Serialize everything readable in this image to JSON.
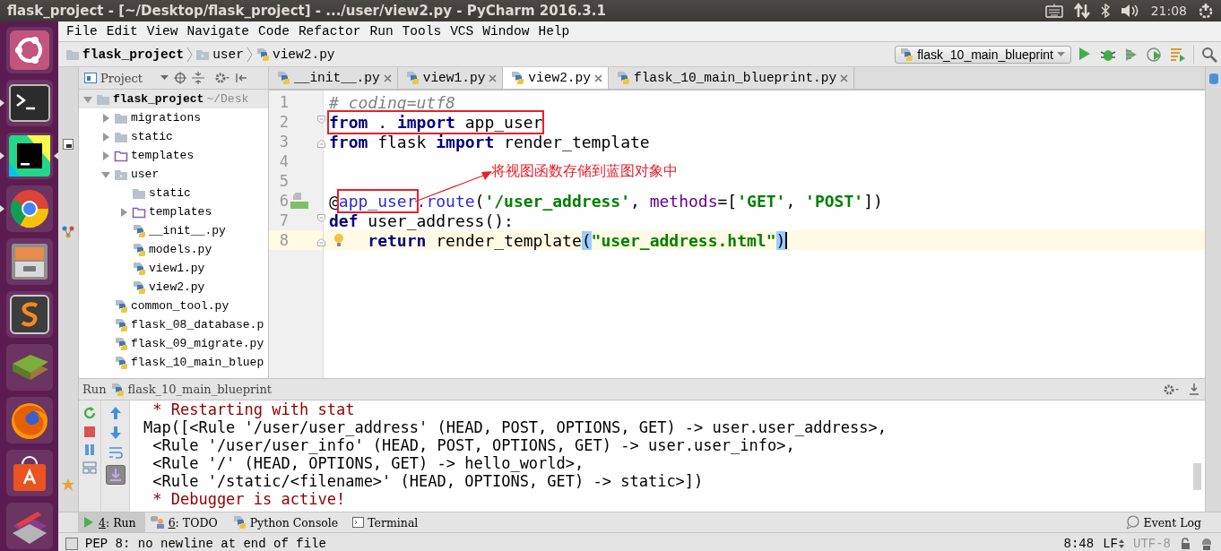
{
  "top_bar": {
    "title": "flask_project - [~/Desktop/flask_project] - .../user/view2.py - PyCharm 2016.3.1",
    "clock": "21:08"
  },
  "launcher": [
    {
      "kind": "ubuntu",
      "running": false,
      "focused": false
    },
    {
      "kind": "terminal",
      "running": true,
      "focused": false
    },
    {
      "kind": "ide",
      "running": true,
      "focused": true
    },
    {
      "kind": "browser",
      "running": true,
      "focused": false
    },
    {
      "kind": "files",
      "running": false,
      "focused": false
    },
    {
      "kind": "text-editor",
      "running": false,
      "focused": false
    },
    {
      "kind": "books",
      "running": false,
      "focused": false
    },
    {
      "kind": "firefox",
      "running": false,
      "focused": false
    },
    {
      "kind": "store",
      "running": false,
      "focused": false
    },
    {
      "kind": "settings",
      "running": false,
      "focused": false
    }
  ],
  "menu": [
    "File",
    "Edit",
    "View",
    "Navigate",
    "Code",
    "Refactor",
    "Run",
    "Tools",
    "VCS",
    "Window",
    "Help"
  ],
  "breadcrumb": [
    {
      "label": "flask_project",
      "kind": "project"
    },
    {
      "label": "user",
      "kind": "package"
    },
    {
      "label": "view2.py",
      "kind": "python-file"
    }
  ],
  "run_config": {
    "label": "flask_10_main_blueprint"
  },
  "project_panel": {
    "title": "Project",
    "tree": [
      {
        "label": "flask_project",
        "hint": "~/Desk",
        "kind": "project",
        "expanded": true,
        "children": [
          {
            "label": "migrations",
            "kind": "folder",
            "expanded": false
          },
          {
            "label": "static",
            "kind": "folder",
            "expanded": false
          },
          {
            "label": "templates",
            "kind": "template-folder",
            "expanded": false
          },
          {
            "label": "user",
            "kind": "package",
            "expanded": true,
            "children": [
              {
                "label": "static",
                "kind": "folder"
              },
              {
                "label": "templates",
                "kind": "template-folder",
                "expanded": false
              },
              {
                "label": "__init__.py",
                "kind": "python-file"
              },
              {
                "label": "models.py",
                "kind": "python-file"
              },
              {
                "label": "view1.py",
                "kind": "python-file"
              },
              {
                "label": "view2.py",
                "kind": "python-file"
              }
            ]
          },
          {
            "label": "common_tool.py",
            "kind": "python-file"
          },
          {
            "label": "flask_08_database.p",
            "kind": "python-file"
          },
          {
            "label": "flask_09_migrate.py",
            "kind": "python-file"
          },
          {
            "label": "flask_10_main_bluep",
            "kind": "python-file"
          }
        ]
      }
    ]
  },
  "editor": {
    "tabs": [
      {
        "label": "__init__.py",
        "selected": false
      },
      {
        "label": "view1.py",
        "selected": false
      },
      {
        "label": "view2.py",
        "selected": true
      },
      {
        "label": "flask_10_main_blueprint.py",
        "selected": false
      }
    ],
    "lines": [
      {
        "number": "1",
        "current": false,
        "fold_start": false,
        "fold_end": false,
        "bookmark": false,
        "bulb": false,
        "tokens": [
          {
            "text": "# coding=utf8",
            "kind": "comment"
          }
        ]
      },
      {
        "number": "2",
        "current": false,
        "fold_start": true,
        "fold_end": false,
        "bookmark": false,
        "bulb": false,
        "tokens": [
          {
            "text": "from",
            "kind": "keyword",
            "boxed": true
          },
          {
            "text": " . ",
            "kind": "plain",
            "boxed": true
          },
          {
            "text": "import",
            "kind": "keyword",
            "boxed": true
          },
          {
            "text": " app_user",
            "kind": "plain",
            "boxed": true
          }
        ]
      },
      {
        "number": "3",
        "current": false,
        "fold_start": false,
        "fold_end": true,
        "bookmark": false,
        "bulb": false,
        "tokens": [
          {
            "text": "from",
            "kind": "keyword"
          },
          {
            "text": " flask ",
            "kind": "plain"
          },
          {
            "text": "import",
            "kind": "keyword"
          },
          {
            "text": " render_template",
            "kind": "plain"
          }
        ]
      },
      {
        "number": "4",
        "current": false,
        "fold_start": false,
        "fold_end": false,
        "bookmark": false,
        "bulb": false
      },
      {
        "number": "5",
        "current": false,
        "fold_start": false,
        "fold_end": false,
        "bookmark": false,
        "bulb": false
      },
      {
        "number": "6",
        "current": false,
        "fold_start": false,
        "fold_end": false,
        "bookmark": true,
        "bulb": false,
        "tokens": [
          {
            "text": "@",
            "kind": "plain"
          },
          {
            "text": "app_user",
            "kind": "decorator",
            "boxed": true
          },
          {
            "text": ".route",
            "kind": "decorator"
          },
          {
            "text": "(",
            "kind": "plain"
          },
          {
            "text": "'/user_address'",
            "kind": "string"
          },
          {
            "text": ", ",
            "kind": "plain"
          },
          {
            "text": "methods",
            "kind": "param"
          },
          {
            "text": "=[",
            "kind": "plain"
          },
          {
            "text": "'GET'",
            "kind": "string"
          },
          {
            "text": ", ",
            "kind": "plain"
          },
          {
            "text": "'POST'",
            "kind": "string"
          },
          {
            "text": "])",
            "kind": "plain"
          }
        ]
      },
      {
        "number": "7",
        "current": false,
        "fold_start": true,
        "fold_end": false,
        "bookmark": false,
        "bulb": false,
        "tokens": [
          {
            "text": "def",
            "kind": "keyword"
          },
          {
            "text": " user_address():",
            "kind": "plain"
          }
        ]
      },
      {
        "number": "8",
        "current": true,
        "fold_start": false,
        "fold_end": true,
        "bookmark": false,
        "bulb": true,
        "tokens": [
          {
            "text": "    return",
            "kind": "keyword"
          },
          {
            "text": " render_template",
            "kind": "plain"
          },
          {
            "text": "(",
            "kind": "brace-match"
          },
          {
            "text": "\"user_address.html\"",
            "kind": "string"
          },
          {
            "text": ")",
            "kind": "brace-match"
          }
        ]
      }
    ],
    "annotation": "将视图函数存储到蓝图对象中"
  },
  "run_panel": {
    "title": "Run",
    "config": "flask_10_main_blueprint",
    "output": [
      {
        "text": " * Restarting with stat",
        "kind": "stderr"
      },
      {
        "text": "Map([<Rule '/user/user_address' (HEAD, POST, OPTIONS, GET) -> user.user_address>,",
        "kind": "stdout"
      },
      {
        "text": " <Rule '/user/user_info' (HEAD, POST, OPTIONS, GET) -> user.user_info>,",
        "kind": "stdout"
      },
      {
        "text": " <Rule '/' (HEAD, OPTIONS, GET) -> hello_world>,",
        "kind": "stdout"
      },
      {
        "text": " <Rule '/static/<filename>' (HEAD, OPTIONS, GET) -> static>])",
        "kind": "stdout"
      },
      {
        "text": " * Debugger is active!",
        "kind": "stderr"
      }
    ]
  },
  "tool_tabs": [
    {
      "mnemonic": "4",
      "label": ": Run",
      "kind": "run",
      "selected": true
    },
    {
      "mnemonic": "6",
      "label": ": TODO",
      "kind": "todo",
      "selected": false
    },
    {
      "label": "Python Console",
      "kind": "console",
      "selected": false
    },
    {
      "label": "Terminal",
      "kind": "terminal",
      "selected": false
    }
  ],
  "event_log": "Event Log",
  "status_bar": {
    "message": "PEP 8: no newline at end of file",
    "position": "8:48",
    "line_separator": "LF",
    "encoding": "UTF-8"
  }
}
